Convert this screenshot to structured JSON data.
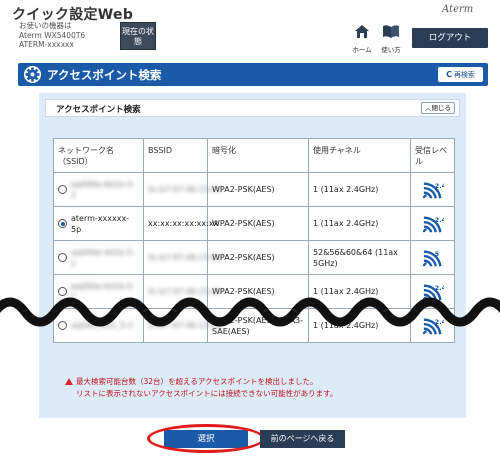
{
  "header": {
    "app_title": "クイック設定Web",
    "device_label": "お使いの機器は",
    "device_model": "Aterm WX5400T6",
    "device_name": "ATERM-xxxxxx",
    "status_button": "現在の状態",
    "brand": "Aterm",
    "home_label": "ホーム",
    "manual_label": "使い方",
    "logout_label": "ログアウト"
  },
  "titlebar": {
    "title": "アクセスポイント検索",
    "rescan_label": "再検索"
  },
  "panel": {
    "title": "アクセスポイント検索",
    "collapse_label": "閉じる"
  },
  "table": {
    "headers": [
      "ネットワーク名（SSID）",
      "BSSID",
      "暗号化",
      "使用チャネル",
      "受信レベル"
    ],
    "rows": [
      {
        "selected": false,
        "ssid": "aq000e-6d1b-5-2",
        "bssid": "5c:b7:97:46:15:0d",
        "encryption": "WPA2-PSK(AES)",
        "channel": "1 (11ax 2.4GHz)",
        "band": "2.4"
      },
      {
        "selected": true,
        "ssid": "aterm-xxxxxx-5p",
        "bssid": "xx:xx:xx:xx:xx:xx",
        "encryption": "WPA2-PSK(AES)",
        "channel": "1 (11ax 2.4GHz)",
        "band": "2.4"
      },
      {
        "selected": false,
        "ssid": "aq000e-4d1b-5-2",
        "bssid": "5c:b7:97:46:15:0d",
        "encryption": "WPA2-PSK(AES)",
        "channel": "52&56&60&64 (11ax 5GHz)",
        "band": "5"
      },
      {
        "selected": false,
        "ssid": "aq000e-6d1b-5-2",
        "bssid": "5c:b7:97:46:15:0d",
        "encryption": "WPA2-PSK(AES)",
        "channel": "1 (11ax 2.4GHz)",
        "band": "2.4"
      },
      {
        "selected": false,
        "ssid": "aq000_R31_5-2",
        "bssid": "5c:b7:97:46:15:0d",
        "encryption": "WPA2-PSK(AES)/WPA3-SAE(AES)",
        "channel": "1 (11ax 2.4GHz)",
        "band": "2.4"
      }
    ]
  },
  "warning": {
    "line1": "最大検索可能台数（32台）を超えるアクセスポイントを検出しました。",
    "line2": "リストに表示されないアクセスポイントには接続できない可能性があります。"
  },
  "buttons": {
    "select_label": "選択",
    "back_label": "前のページへ戻る"
  },
  "colors": {
    "title_blue": "#1a5aa8",
    "panel_bg": "#dcebf7",
    "warning_red": "#c0121a",
    "highlight_red": "#e11a1a",
    "dark_button": "#2a3d55"
  }
}
